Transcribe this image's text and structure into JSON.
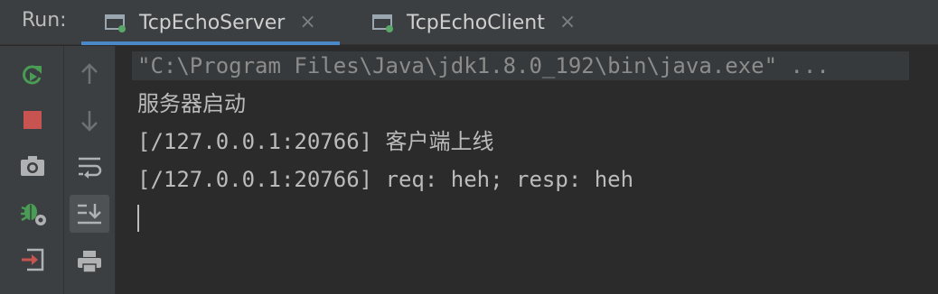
{
  "tabbar": {
    "run_label": "Run:",
    "tabs": [
      {
        "label": "TcpEchoServer",
        "close": "×",
        "active": true
      },
      {
        "label": "TcpEchoClient",
        "close": "×",
        "active": false
      }
    ]
  },
  "toolbar": {
    "primary": [
      {
        "icon": "rerun-icon",
        "color": "#499c54"
      },
      {
        "icon": "stop-icon",
        "color": "#c75450"
      },
      {
        "icon": "camera-icon",
        "color": "#afb1b3"
      },
      {
        "icon": "bug-settings-icon",
        "color": "#499c54"
      },
      {
        "icon": "exit-icon",
        "color": "#c75450"
      }
    ],
    "secondary": [
      {
        "icon": "arrow-up-icon"
      },
      {
        "icon": "arrow-down-icon"
      },
      {
        "icon": "soft-wrap-icon"
      },
      {
        "icon": "scroll-to-end-icon",
        "selected": true
      },
      {
        "icon": "print-icon"
      }
    ]
  },
  "console": {
    "lines": [
      "\"C:\\Program Files\\Java\\jdk1.8.0_192\\bin\\java.exe\" ...",
      "服务器启动",
      "[/127.0.0.1:20766] 客户端上线",
      "[/127.0.0.1:20766] req: heh; resp: heh"
    ]
  },
  "colors": {
    "accent": "#4a88c7",
    "background": "#2b2b2b",
    "panel": "#3c3f41",
    "text": "#bbbbbb"
  }
}
